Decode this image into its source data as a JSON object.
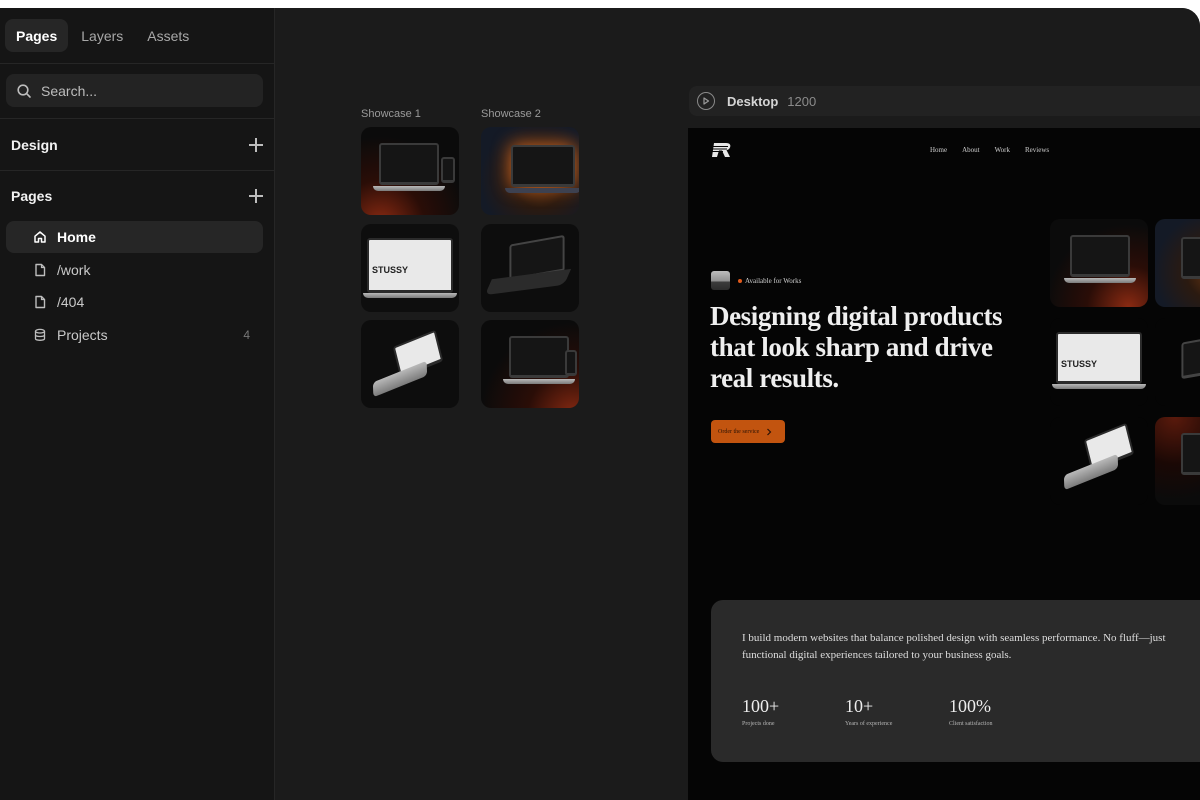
{
  "sidebar": {
    "tabs": [
      {
        "label": "Pages",
        "active": true
      },
      {
        "label": "Layers",
        "active": false
      },
      {
        "label": "Assets",
        "active": false
      }
    ],
    "search": {
      "placeholder": "Search..."
    },
    "sections": {
      "design": {
        "title": "Design"
      },
      "pages": {
        "title": "Pages"
      }
    },
    "pages": [
      {
        "label": "Home",
        "icon": "home-icon",
        "active": true
      },
      {
        "label": "/work",
        "icon": "file-icon",
        "active": false
      },
      {
        "label": "/404",
        "icon": "file-icon",
        "active": false
      },
      {
        "label": "Projects",
        "icon": "database-icon",
        "count": "4",
        "active": false
      }
    ]
  },
  "canvas": {
    "showcase_1": {
      "label": "Showcase 1"
    },
    "showcase_2": {
      "label": "Showcase 2"
    },
    "breakpoint": {
      "name": "Desktop",
      "width": "1200"
    }
  },
  "preview": {
    "nav": [
      "Home",
      "About",
      "Work",
      "Reviews"
    ],
    "availability": "Available for Works",
    "hero_title": "Designing digital products that look sharp and drive real results.",
    "cta_label": "Order the service",
    "intro": "I build modern websites that balance polished design with seamless performance. No fluff—just functional digital experiences tailored to your business goals.",
    "stats": [
      {
        "value": "100+",
        "label": "Projects done"
      },
      {
        "value": "10+",
        "label": "Years of experience"
      },
      {
        "value": "100%",
        "label": "Client satisfaction"
      }
    ],
    "thumb_text": "STUSSY"
  },
  "colors": {
    "accent": "#c2540f",
    "status_dot": "#e05a1c",
    "sidebar_bg": "#151515",
    "canvas_bg": "#1b1b1b"
  }
}
